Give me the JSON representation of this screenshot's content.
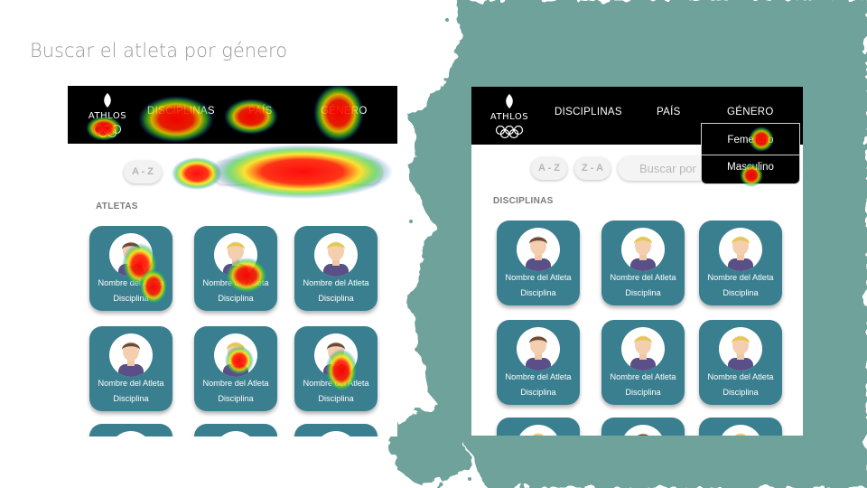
{
  "slide": {
    "title": "Buscar el atleta por género"
  },
  "colors": {
    "teal": "#6ea29a",
    "card": "#3a7f8f",
    "navbar": "#000000"
  },
  "left_screen": {
    "logo": "ATHLOS",
    "nav": [
      "DISCIPLINAS",
      "PAÍS",
      "GÉNERO"
    ],
    "sort_az": "A - Z",
    "section": "ATLETAS",
    "cards": [
      {
        "name": "Nombre del Atleta",
        "discipline": "Disciplina",
        "hair": "#6b4a3a"
      },
      {
        "name": "Nombre del Atleta",
        "discipline": "Disciplina",
        "hair": "#e6c84a"
      },
      {
        "name": "Nombre del Atleta",
        "discipline": "Disciplina",
        "hair": "#e6c84a"
      },
      {
        "name": "Nombre del Atleta",
        "discipline": "Disciplina",
        "hair": "#6b4a3a"
      },
      {
        "name": "Nombre del Atleta",
        "discipline": "Disciplina",
        "hair": "#e6c84a"
      },
      {
        "name": "Nombre del Atleta",
        "discipline": "Disciplina",
        "hair": "#6b4a3a"
      }
    ]
  },
  "right_screen": {
    "logo": "ATHLOS",
    "nav": [
      "DISCIPLINAS",
      "PAÍS",
      "GÉNERO"
    ],
    "sort_az": "A - Z",
    "sort_za": "Z - A",
    "search_placeholder": "Buscar por",
    "section": "DISCIPLINAS",
    "dropdown": [
      "Femenino",
      "Masculino"
    ],
    "cards": [
      {
        "name": "Nombre del Atleta",
        "discipline": "Disciplina",
        "hair": "#6b4a3a"
      },
      {
        "name": "Nombre del Atleta",
        "discipline": "Disciplina",
        "hair": "#e6c84a"
      },
      {
        "name": "Nombre del Atleta",
        "discipline": "Disciplina",
        "hair": "#e6c84a"
      },
      {
        "name": "Nombre del Atleta",
        "discipline": "Disciplina",
        "hair": "#6b4a3a"
      },
      {
        "name": "Nombre del Atleta",
        "discipline": "Disciplina",
        "hair": "#e6c84a"
      },
      {
        "name": "Nombre del Atleta",
        "discipline": "Disciplina",
        "hair": "#e6c84a"
      }
    ]
  }
}
